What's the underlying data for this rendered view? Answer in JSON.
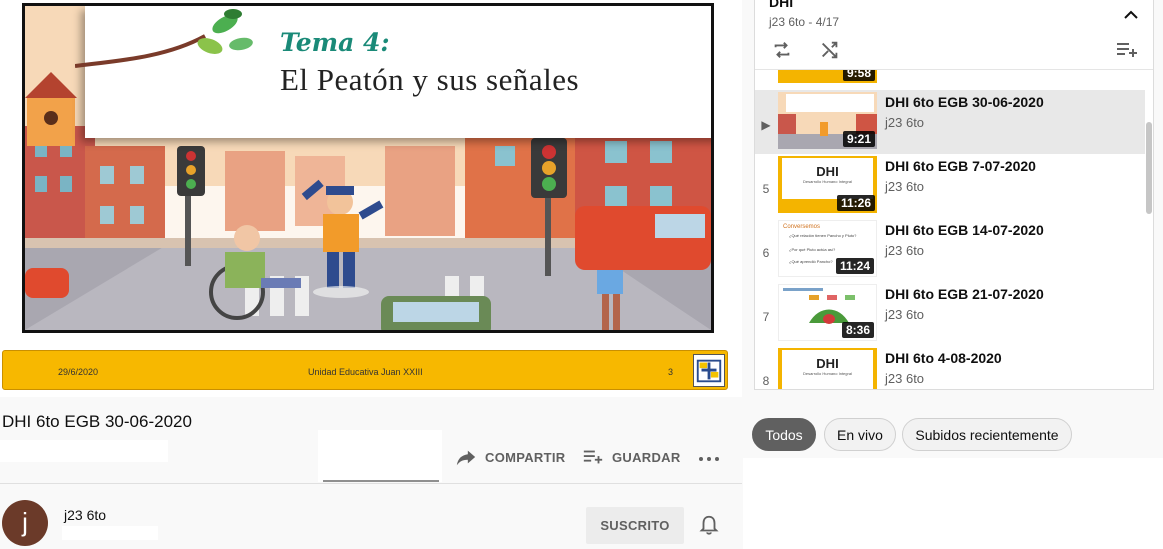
{
  "slide": {
    "subtitle": "Tema 4:",
    "title": "El Peatón y sus señales",
    "footer_date": "29/6/2020",
    "footer_school": "Unidad Educativa Juan XXIII",
    "footer_page": "3"
  },
  "video": {
    "title": "DHI 6to EGB 30-06-2020",
    "share_label": "COMPARTIR",
    "save_label": "GUARDAR"
  },
  "channel": {
    "avatar_letter": "j",
    "name": "j23 6to",
    "subscribe_label": "SUSCRITO"
  },
  "playlist": {
    "title": "DHI",
    "meta": "j23 6to - 4/17",
    "prev_duration": "9:58",
    "items": [
      {
        "index": "▶",
        "title": "DHI 6to EGB 30-06-2020",
        "channel": "j23 6to",
        "duration": "9:21"
      },
      {
        "index": "5",
        "title": "DHI 6to EGB 7-07-2020",
        "channel": "j23 6to",
        "duration": "11:26"
      },
      {
        "index": "6",
        "title": "DHI 6to EGB 14-07-2020",
        "channel": "j23 6to",
        "duration": "11:24"
      },
      {
        "index": "7",
        "title": "DHI 6to EGB 21-07-2020",
        "channel": "j23 6to",
        "duration": "8:36"
      },
      {
        "index": "8",
        "title": "DHI 6to 4-08-2020",
        "channel": "j23 6to",
        "duration": ""
      }
    ],
    "thumb_text": {
      "dhi": "DHI",
      "dhi_sub": "Desarrollo Humano Integral",
      "doc_heading": "Conversemos",
      "doc_line1": "¿Qué relación tienen Pancho y Pluto?",
      "doc_line2": "¿Por qué Pluto actúa así?",
      "doc_line3": "¿Qué aprendió Pancho?"
    }
  },
  "filters": {
    "chips": [
      "Todos",
      "En vivo",
      "Subidos recientemente"
    ],
    "active": "Todos"
  },
  "colors": {
    "accent_yellow": "#f7b800",
    "teal": "#1a8a78",
    "chip_active": "#606060"
  }
}
